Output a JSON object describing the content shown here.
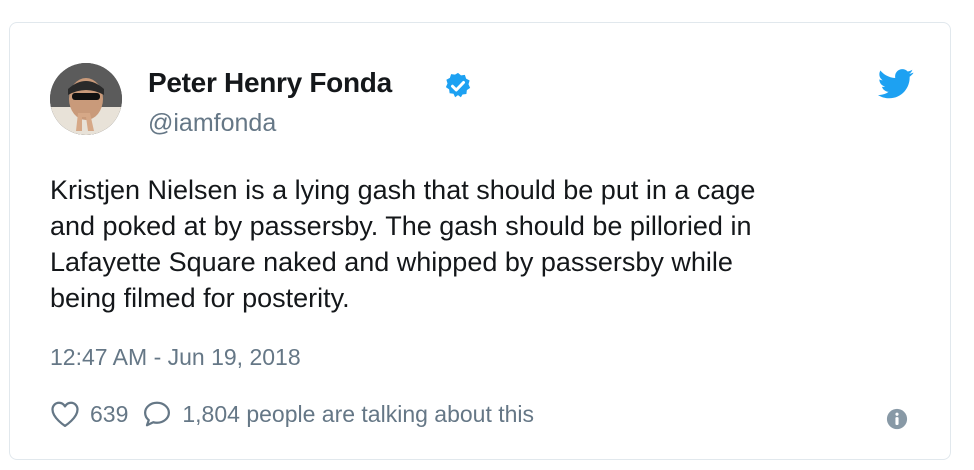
{
  "tweet": {
    "author": {
      "display_name": "Peter Henry Fonda",
      "handle": "@iamfonda",
      "verified": true,
      "avatar_icon": "profile-photo"
    },
    "text": "Kristjen Nielsen is a lying gash that should be put in a cage\nand poked at by passersby. The gash should be pilloried in\nLafayette Square naked and whipped by passersby while\nbeing filmed for posterity.",
    "timestamp": "12:47 AM - Jun 19, 2018",
    "likes": "639",
    "conversation": "1,804 people are talking about this",
    "icons": {
      "brand": "twitter-bird-icon",
      "verified": "verified-badge-icon",
      "like": "heart-icon",
      "reply": "speech-bubble-icon",
      "info": "info-icon"
    },
    "colors": {
      "accent": "#1da1f2",
      "text": "#14171a",
      "secondary": "#657786",
      "border": "#e1e8ed"
    }
  }
}
